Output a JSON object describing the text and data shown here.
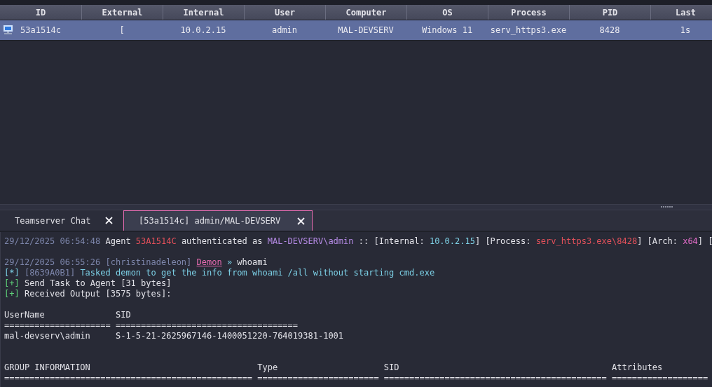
{
  "agents_table": {
    "columns": [
      "ID",
      "External",
      "Internal",
      "User",
      "Computer",
      "OS",
      "Process",
      "PID",
      "Last"
    ],
    "rows": [
      {
        "selected": true,
        "cells": [
          "53a1514c",
          "[",
          "10.0.2.15",
          "admin",
          "MAL-DEVSERV",
          "Windows 11",
          "serv_https3.exe",
          "8428",
          "1s"
        ]
      }
    ]
  },
  "tabs": [
    {
      "label": "Teamserver Chat",
      "selected": false
    },
    {
      "label": "[53a1514c] admin/MAL-DEVSERV",
      "selected": true
    }
  ],
  "console": {
    "lines": [
      {
        "kind": "segments",
        "segments": [
          {
            "text": "29/12/2025 06:54:48 ",
            "kind": "time"
          },
          {
            "text": "Agent ",
            "kind": "plain"
          },
          {
            "text": "53A1514C",
            "kind": "agent-id"
          },
          {
            "text": " authenticated as ",
            "kind": "plain"
          },
          {
            "text": "MAL-DEVSERV\\admin",
            "kind": "user"
          },
          {
            "text": " :: [Internal: ",
            "kind": "plain"
          },
          {
            "text": "10.0.2.15",
            "kind": "ip"
          },
          {
            "text": "] [Process: ",
            "kind": "plain"
          },
          {
            "text": "serv_https3.exe\\8428",
            "kind": "process"
          },
          {
            "text": "] [Arch: ",
            "kind": "plain"
          },
          {
            "text": "x64",
            "kind": "arch"
          },
          {
            "text": "] [",
            "kind": "plain"
          }
        ]
      },
      {
        "kind": "blank"
      },
      {
        "kind": "segments",
        "segments": [
          {
            "text": "29/12/2025 06:55:26 [christinadeleon] ",
            "kind": "time"
          },
          {
            "text": "Demon",
            "kind": "link"
          },
          {
            "text": " » ",
            "kind": "info"
          },
          {
            "text": "whoami",
            "kind": "plain"
          }
        ]
      },
      {
        "kind": "segments",
        "segments": [
          {
            "text": "[*] ",
            "kind": "info-mark"
          },
          {
            "text": "[8639A0B1] ",
            "kind": "time"
          },
          {
            "text": "Tasked demon to get the info from whoami /all without starting cmd.exe",
            "kind": "info"
          }
        ]
      },
      {
        "kind": "segments",
        "segments": [
          {
            "text": "[+] ",
            "kind": "ok-mark"
          },
          {
            "text": "Send Task to Agent [31 bytes]",
            "kind": "plain"
          }
        ]
      },
      {
        "kind": "segments",
        "segments": [
          {
            "text": "[+] ",
            "kind": "ok-mark"
          },
          {
            "text": "Received Output [3575 bytes]:",
            "kind": "plain"
          }
        ]
      },
      {
        "kind": "blank"
      },
      {
        "kind": "output",
        "text": "UserName              SID"
      },
      {
        "kind": "output",
        "text": "===================== ===================================="
      },
      {
        "kind": "output",
        "text": "mal-devserv\\admin     S-1-5-21-2625967146-1400051220-764019381-1001"
      },
      {
        "kind": "blank"
      },
      {
        "kind": "blank"
      },
      {
        "kind": "output",
        "text": "GROUP INFORMATION                                 Type                     SID                                          Attributes"
      },
      {
        "kind": "output",
        "text": "================================================= ======================== ============================================ ==================="
      }
    ]
  }
}
